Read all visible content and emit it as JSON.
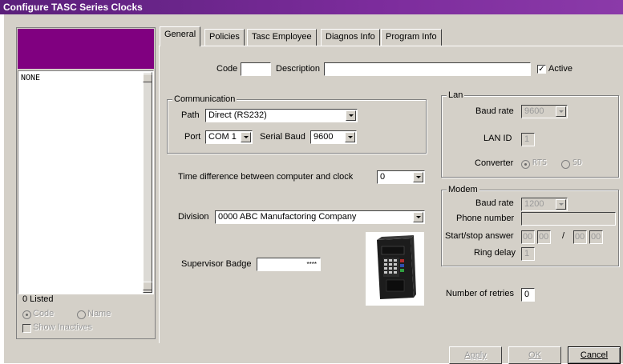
{
  "window": {
    "title": "Configure TASC Series Clocks"
  },
  "left_panel": {
    "list_value": "NONE",
    "listed_count": "0 Listed",
    "sort_code": "Code",
    "sort_name": "Name",
    "show_inactives": "Show Inactives"
  },
  "tabs": [
    "General",
    "Policies",
    "Tasc Employee",
    "Diagnos Info",
    "Program Info"
  ],
  "general": {
    "code_label": "Code",
    "code_value": "",
    "description_label": "Description",
    "description_value": "",
    "active_label": "Active",
    "active_checked": true,
    "communication": {
      "legend": "Communication",
      "path_label": "Path",
      "path_value": "Direct (RS232)",
      "port_label": "Port",
      "port_value": "COM 1",
      "serial_baud_label": "Serial Baud",
      "serial_baud_value": "9600"
    },
    "time_diff_label": "Time difference between computer and clock",
    "time_diff_value": "0",
    "division_label": "Division",
    "division_value": "0000  ABC Manufactoring Company",
    "supervisor_badge_label": "Supervisor Badge",
    "supervisor_badge_value": "****",
    "lan": {
      "legend": "Lan",
      "baud_rate_label": "Baud rate",
      "baud_rate_value": "9600",
      "lan_id_label": "LAN ID",
      "lan_id_value": "1",
      "converter_label": "Converter",
      "converter_rts": "RTS",
      "converter_sd": "SD"
    },
    "modem": {
      "legend": "Modem",
      "baud_rate_label": "Baud rate",
      "baud_rate_value": "1200",
      "phone_label": "Phone number",
      "phone_value": "",
      "start_stop_label": "Start/stop answer",
      "start_h": "00",
      "start_m": "00",
      "slash": "/",
      "stop_h": "00",
      "stop_m": "00",
      "ring_delay_label": "Ring delay",
      "ring_delay_value": "1"
    },
    "retries_label": "Number of retries",
    "retries_value": "0"
  },
  "buttons": {
    "apply": "Apply",
    "ok": "OK",
    "cancel": "Cancel"
  },
  "colors": {
    "title_purple": "#7c2c9c",
    "header_purple": "#800080",
    "face": "#d4d0c8"
  }
}
